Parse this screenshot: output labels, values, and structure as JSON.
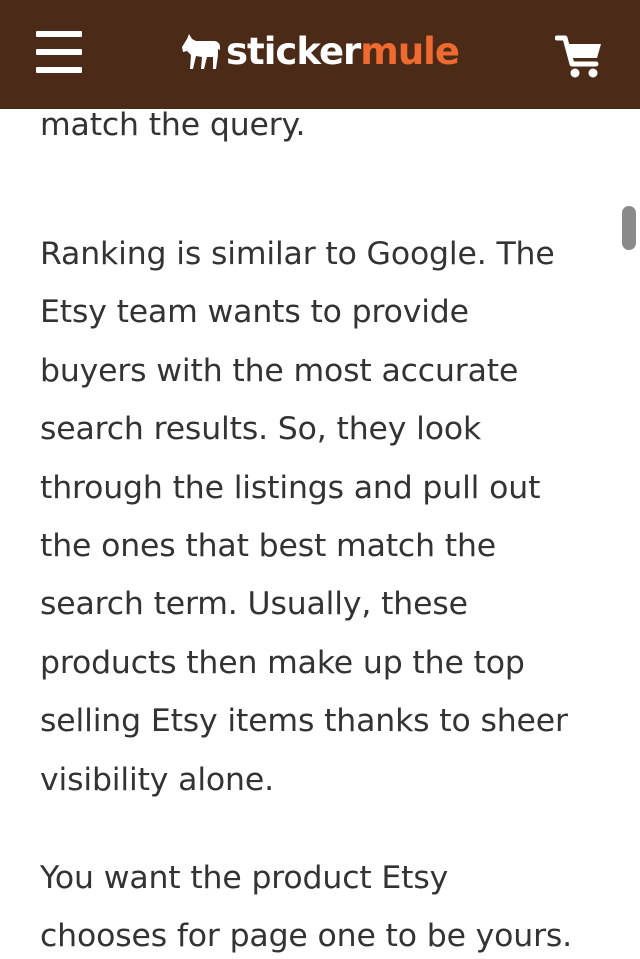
{
  "header": {
    "menu_icon": "hamburger-menu-icon",
    "logo_icon": "mule-icon",
    "logo_part1": "sticker",
    "logo_part2": "mule",
    "cart_icon": "shopping-cart-icon",
    "colors": {
      "background": "#4b2a18",
      "logo_accent": "#ef6a2f",
      "logo_main": "#ffffff"
    }
  },
  "article": {
    "paragraphs": [
      "match the query.",
      "Ranking is similar to Google. The\nEtsy team wants to provide\nbuyers with the most accurate\nsearch results. So, they look\nthrough the listings and pull out\nthe ones that best match the\nsearch term. Usually, these\nproducts then make up the top\nselling Etsy items thanks to sheer\nvisibility alone.",
      "You want the product Etsy\nchooses for page one to be yours."
    ],
    "text_color": "#333333"
  }
}
